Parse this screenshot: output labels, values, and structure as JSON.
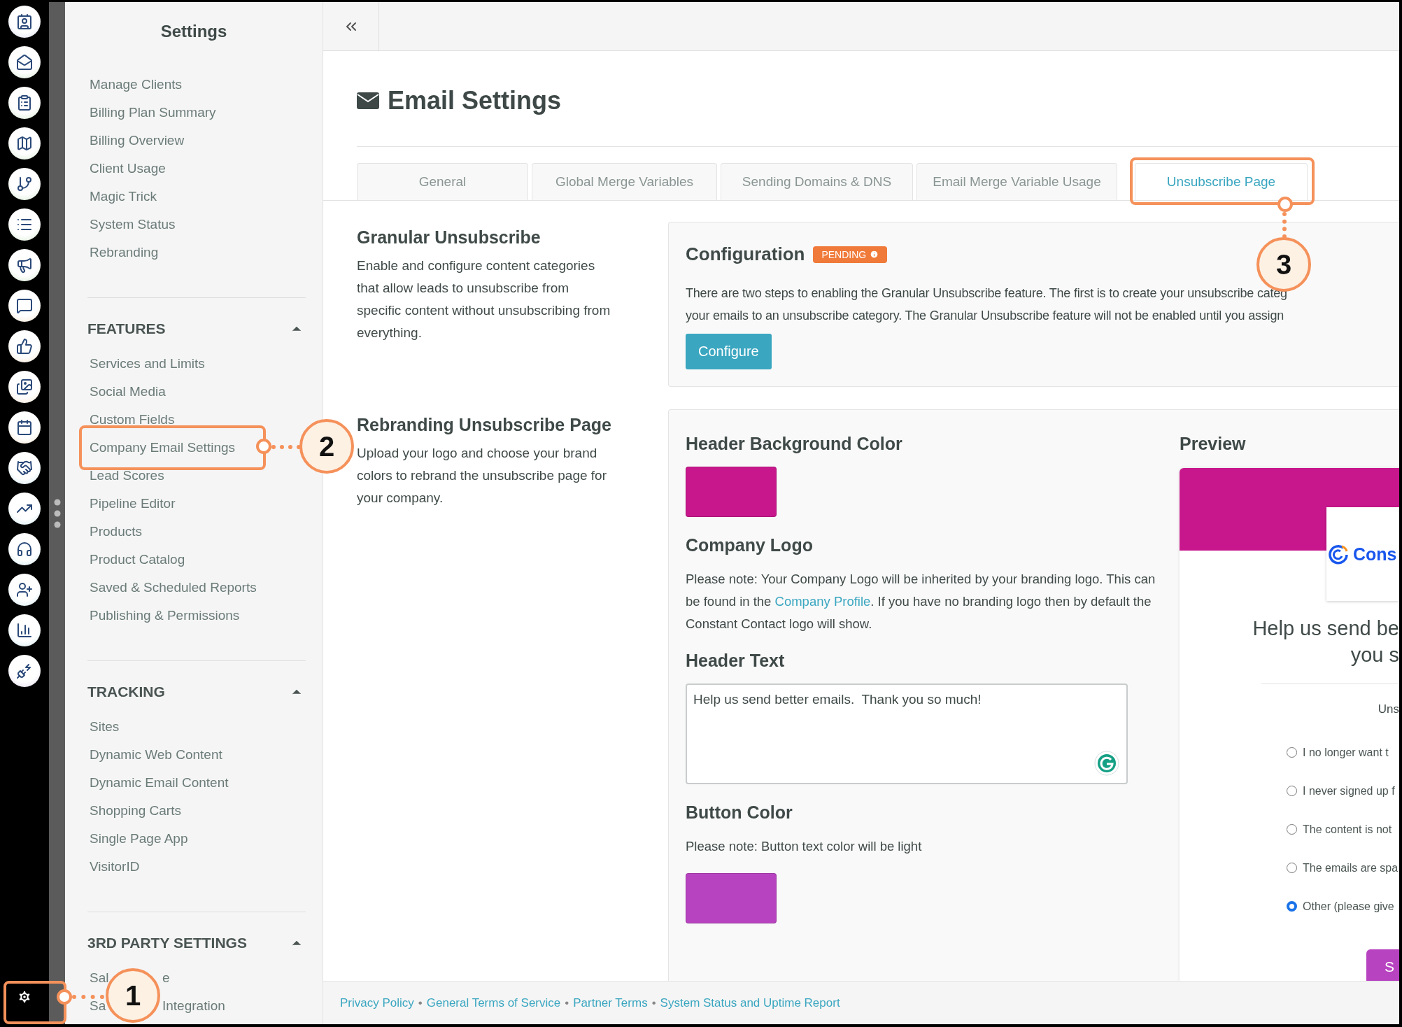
{
  "sidebar": {
    "title": "Settings",
    "top_items": [
      {
        "label": "Manage Clients"
      },
      {
        "label": "Billing Plan Summary"
      },
      {
        "label": "Billing Overview"
      },
      {
        "label": "Client Usage"
      },
      {
        "label": "Magic Trick"
      },
      {
        "label": "System Status"
      },
      {
        "label": "Rebranding"
      }
    ],
    "sections": [
      {
        "title": "FEATURES",
        "expanded": true,
        "items": [
          {
            "label": "Services and Limits"
          },
          {
            "label": "Social Media"
          },
          {
            "label": "Custom Fields"
          },
          {
            "label": "Company Email Settings"
          },
          {
            "label": "Lead Scores"
          },
          {
            "label": "Pipeline Editor"
          },
          {
            "label": "Products"
          },
          {
            "label": "Product Catalog"
          },
          {
            "label": "Saved & Scheduled Reports"
          },
          {
            "label": "Publishing & Permissions"
          }
        ]
      },
      {
        "title": "TRACKING",
        "expanded": true,
        "items": [
          {
            "label": "Sites"
          },
          {
            "label": "Dynamic Web Content"
          },
          {
            "label": "Dynamic Email Content"
          },
          {
            "label": "Shopping Carts"
          },
          {
            "label": "Single Page App"
          },
          {
            "label": "VisitorID"
          }
        ]
      },
      {
        "title": "3RD PARTY SETTINGS",
        "expanded": true,
        "items": [
          {
            "label": "Sal",
            "label_after": "e"
          },
          {
            "label": "Sa",
            "label_after": "Integration"
          }
        ]
      }
    ]
  },
  "main": {
    "title": "Email Settings",
    "tabs": [
      {
        "label": "General",
        "selected": false
      },
      {
        "label": "Global Merge Variables",
        "selected": false
      },
      {
        "label": "Sending Domains & DNS",
        "selected": false
      },
      {
        "label": "Email Merge Variable Usage",
        "selected": false
      },
      {
        "label": "Unsubscribe Page",
        "selected": true
      }
    ],
    "granular": {
      "title": "Granular Unsubscribe",
      "description": "Enable and configure content categories that allow leads to unsubscribe from specific content without unsubscribing from everything."
    },
    "configuration": {
      "title": "Configuration",
      "status": "PENDING",
      "lines": [
        "There are two steps to enabling the Granular Unsubscribe feature. The first is to create your unsubscribe categ",
        "your emails to an unsubscribe category. The Granular Unsubscribe feature will not be enabled until you assign"
      ],
      "button": "Configure"
    },
    "rebranding": {
      "title": "Rebranding Unsubscribe Page",
      "description": "Upload your logo and choose your brand colors to rebrand the unsubscribe page for your company."
    },
    "branding": {
      "header_color": {
        "title": "Header Background Color",
        "color": "#c8178c"
      },
      "logo": {
        "title": "Company Logo",
        "note_before": "Please note: Your Company Logo will be inherited by your branding logo. This can be found in the ",
        "link": "Company Profile",
        "note_after": ". If you have no branding logo then by default the Constant Contact logo will show."
      },
      "header_text": {
        "title": "Header Text",
        "value": "Help us send better emails.  Thank you so much!"
      },
      "button_color": {
        "title": "Button Color",
        "note": "Please note: Button text color will be light",
        "color": "#b843c0"
      }
    },
    "preview": {
      "title": "Preview",
      "logo_text": "Cons",
      "heading_lines": [
        "Help us send be",
        "you s"
      ],
      "prompt": "Uns",
      "options": [
        {
          "label": "I no longer want t",
          "selected": false
        },
        {
          "label": "I never signed up f",
          "selected": false
        },
        {
          "label": "The content is not",
          "selected": false
        },
        {
          "label": "The emails are spa",
          "selected": false
        },
        {
          "label": "Other (please give",
          "selected": true
        }
      ],
      "submit": "S"
    }
  },
  "footer": {
    "items": [
      {
        "kind": "link",
        "text": "Privacy Policy"
      },
      {
        "kind": "separator",
        "text": "•"
      },
      {
        "kind": "link",
        "text": "General Terms of Service"
      },
      {
        "kind": "separator",
        "text": "•"
      },
      {
        "kind": "link",
        "text": "Partner Terms"
      },
      {
        "kind": "separator",
        "text": "•"
      },
      {
        "kind": "link",
        "text": "System Status and Uptime Report"
      }
    ]
  },
  "callouts": [
    {
      "number": "1"
    },
    {
      "number": "2"
    },
    {
      "number": "3"
    }
  ]
}
